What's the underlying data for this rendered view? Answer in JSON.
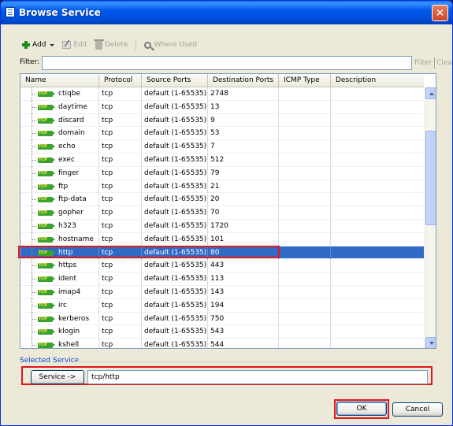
{
  "window": {
    "title": "Browse Service"
  },
  "toolbar": {
    "add_label": "Add",
    "edit_label": "Edit",
    "delete_label": "Delete",
    "where_used_label": "Where Used"
  },
  "filter": {
    "label": "Filter:",
    "value": "",
    "filter_button": "Filter",
    "clear_button": "Clear"
  },
  "table": {
    "columns": [
      "Name",
      "Protocol",
      "Source Ports",
      "Destination Ports",
      "ICMP Type",
      "Description"
    ],
    "rows": [
      {
        "name": "ctiqbe",
        "protocol": "tcp",
        "source": "default (1-65535)",
        "dest": "2748",
        "icmp": "",
        "desc": ""
      },
      {
        "name": "daytime",
        "protocol": "tcp",
        "source": "default (1-65535)",
        "dest": "13",
        "icmp": "",
        "desc": ""
      },
      {
        "name": "discard",
        "protocol": "tcp",
        "source": "default (1-65535)",
        "dest": "9",
        "icmp": "",
        "desc": ""
      },
      {
        "name": "domain",
        "protocol": "tcp",
        "source": "default (1-65535)",
        "dest": "53",
        "icmp": "",
        "desc": ""
      },
      {
        "name": "echo",
        "protocol": "tcp",
        "source": "default (1-65535)",
        "dest": "7",
        "icmp": "",
        "desc": ""
      },
      {
        "name": "exec",
        "protocol": "tcp",
        "source": "default (1-65535)",
        "dest": "512",
        "icmp": "",
        "desc": ""
      },
      {
        "name": "finger",
        "protocol": "tcp",
        "source": "default (1-65535)",
        "dest": "79",
        "icmp": "",
        "desc": ""
      },
      {
        "name": "ftp",
        "protocol": "tcp",
        "source": "default (1-65535)",
        "dest": "21",
        "icmp": "",
        "desc": ""
      },
      {
        "name": "ftp-data",
        "protocol": "tcp",
        "source": "default (1-65535)",
        "dest": "20",
        "icmp": "",
        "desc": ""
      },
      {
        "name": "gopher",
        "protocol": "tcp",
        "source": "default (1-65535)",
        "dest": "70",
        "icmp": "",
        "desc": ""
      },
      {
        "name": "h323",
        "protocol": "tcp",
        "source": "default (1-65535)",
        "dest": "1720",
        "icmp": "",
        "desc": ""
      },
      {
        "name": "hostname",
        "protocol": "tcp",
        "source": "default (1-65535)",
        "dest": "101",
        "icmp": "",
        "desc": ""
      },
      {
        "name": "http",
        "protocol": "tcp",
        "source": "default (1-65535)",
        "dest": "80",
        "icmp": "",
        "desc": "",
        "selected": true
      },
      {
        "name": "https",
        "protocol": "tcp",
        "source": "default (1-65535)",
        "dest": "443",
        "icmp": "",
        "desc": ""
      },
      {
        "name": "ident",
        "protocol": "tcp",
        "source": "default (1-65535)",
        "dest": "113",
        "icmp": "",
        "desc": ""
      },
      {
        "name": "imap4",
        "protocol": "tcp",
        "source": "default (1-65535)",
        "dest": "143",
        "icmp": "",
        "desc": ""
      },
      {
        "name": "irc",
        "protocol": "tcp",
        "source": "default (1-65535)",
        "dest": "194",
        "icmp": "",
        "desc": ""
      },
      {
        "name": "kerberos",
        "protocol": "tcp",
        "source": "default (1-65535)",
        "dest": "750",
        "icmp": "",
        "desc": ""
      },
      {
        "name": "klogin",
        "protocol": "tcp",
        "source": "default (1-65535)",
        "dest": "543",
        "icmp": "",
        "desc": ""
      },
      {
        "name": "kshell",
        "protocol": "tcp",
        "source": "default (1-65535)",
        "dest": "544",
        "icmp": "",
        "desc": ""
      }
    ],
    "row_icon_text": "TCP"
  },
  "selected_service": {
    "section_label": "Selected Service",
    "button_label": "Service ->",
    "value": "tcp/http"
  },
  "buttons": {
    "ok": "OK",
    "cancel": "Cancel"
  },
  "colors": {
    "selection": "#316ac5",
    "highlight": "#e0181b",
    "title_bar": "#0058ee"
  }
}
